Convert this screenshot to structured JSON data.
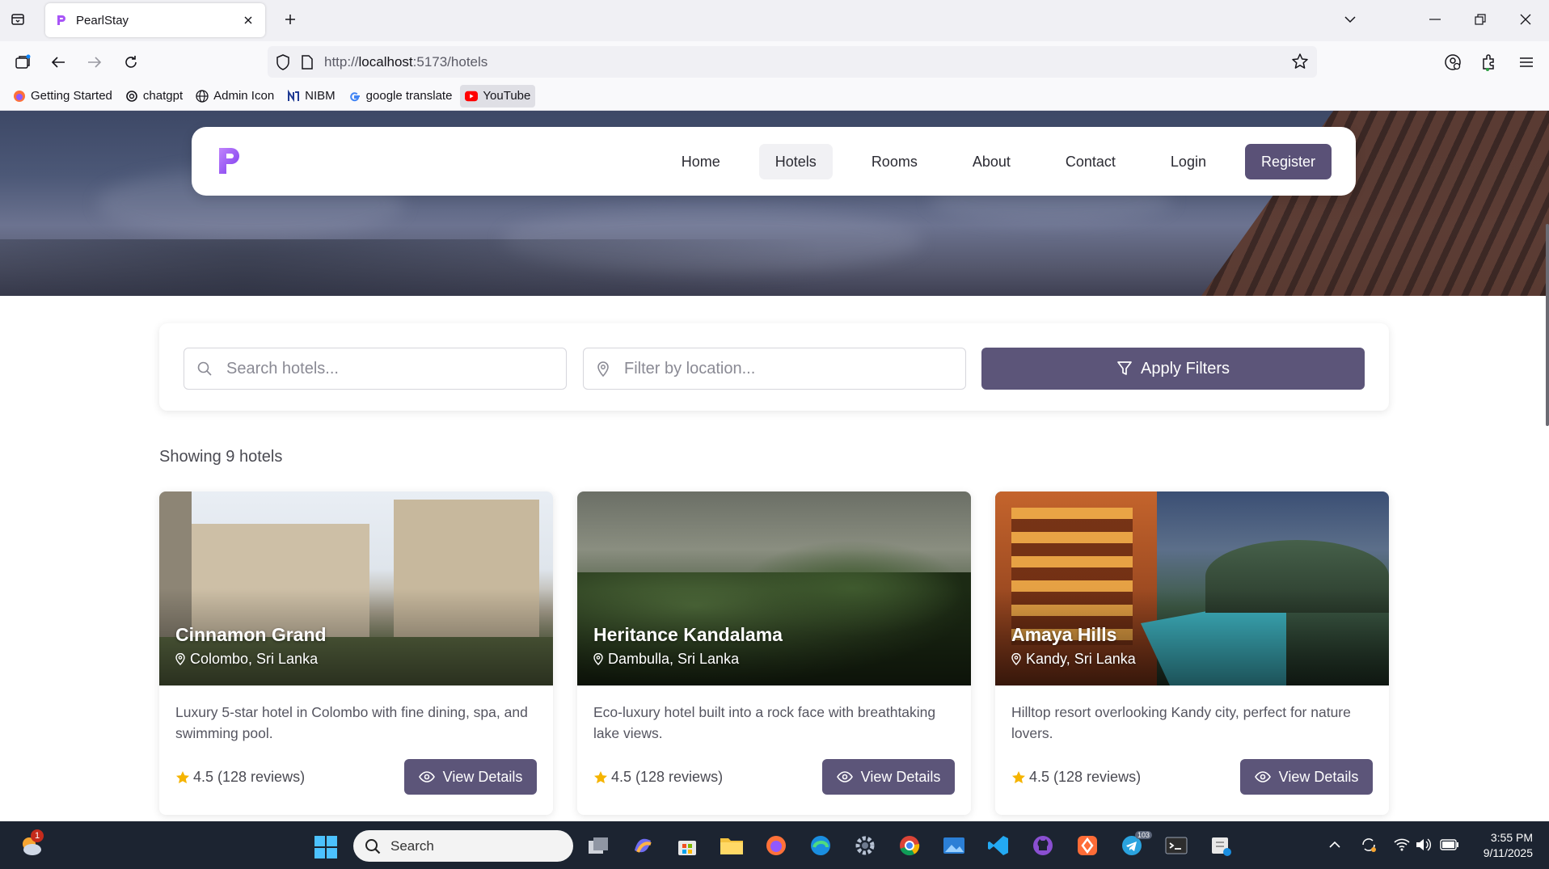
{
  "browser": {
    "tab_title": "PearlStay",
    "url_scheme": "http://",
    "url_host": "localhost",
    "url_rest": ":5173/hotels",
    "bookmarks": [
      {
        "label": "Getting Started",
        "icon": "firefox-icon"
      },
      {
        "label": "chatgpt",
        "icon": "openai-icon"
      },
      {
        "label": "Admin Icon",
        "icon": "globe-icon"
      },
      {
        "label": "NIBM",
        "icon": "nibm-icon"
      },
      {
        "label": "google translate",
        "icon": "google-icon"
      },
      {
        "label": "YouTube",
        "icon": "youtube-icon"
      }
    ]
  },
  "nav": {
    "items": [
      "Home",
      "Hotels",
      "Rooms",
      "About",
      "Contact",
      "Login"
    ],
    "active": "Hotels",
    "register": "Register"
  },
  "filters": {
    "search_placeholder": "Search hotels...",
    "location_placeholder": "Filter by location...",
    "apply_label": "Apply Filters"
  },
  "results_text": "Showing 9 hotels",
  "hotels": [
    {
      "name": "Cinnamon Grand",
      "location": "Colombo, Sri Lanka",
      "description": "Luxury 5-star hotel in Colombo with fine dining, spa, and swimming pool.",
      "rating": "4.5 (128 reviews)",
      "button": "View Details"
    },
    {
      "name": "Heritance Kandalama",
      "location": "Dambulla, Sri Lanka",
      "description": "Eco-luxury hotel built into a rock face with breathtaking lake views.",
      "rating": "4.5 (128 reviews)",
      "button": "View Details"
    },
    {
      "name": "Amaya Hills",
      "location": "Kandy, Sri Lanka",
      "description": "Hilltop resort overlooking Kandy city, perfect for nature lovers.",
      "rating": "4.5 (128 reviews)",
      "button": "View Details"
    }
  ],
  "colors": {
    "accent": "#5c5579",
    "logo": "#a855f7",
    "star": "#f5b400",
    "taskbar": "#1c2431"
  },
  "taskbar": {
    "search_placeholder": "Search",
    "notification_count": "1",
    "time": "3:55 PM",
    "date": "9/11/2025",
    "telegram_badge": "103"
  }
}
